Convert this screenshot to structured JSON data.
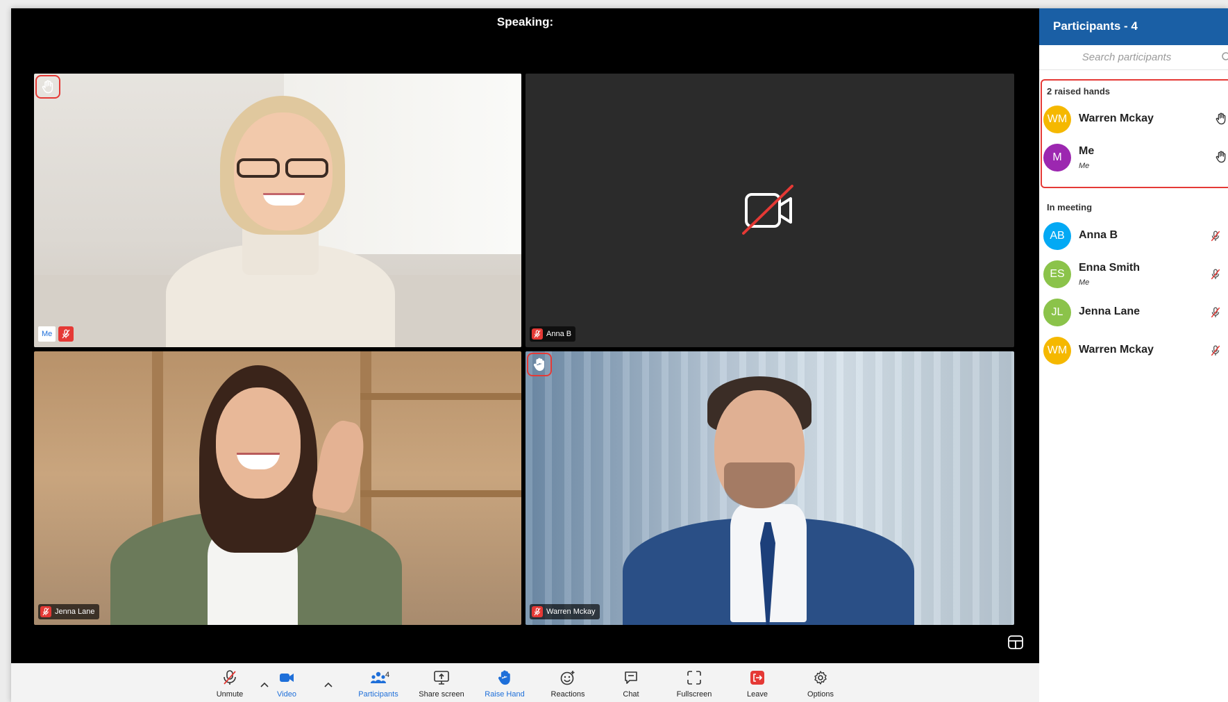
{
  "stage": {
    "speaking_label": "Speaking:"
  },
  "tiles": {
    "me": {
      "label": "Me",
      "hand_raised": true,
      "muted": true
    },
    "anna": {
      "label": "Anna B",
      "camera_off": true,
      "muted": true
    },
    "jenna": {
      "label": "Jenna Lane",
      "muted": true
    },
    "warren": {
      "label": "Warren Mckay",
      "hand_raised": true,
      "muted": true
    }
  },
  "toolbar": {
    "unmute": "Unmute",
    "video": "Video",
    "participants": "Participants",
    "participants_count": "4",
    "share_screen": "Share screen",
    "raise_hand": "Raise Hand",
    "reactions": "Reactions",
    "chat": "Chat",
    "fullscreen": "Fullscreen",
    "leave": "Leave",
    "options": "Options"
  },
  "panel": {
    "title": "Participants - 4",
    "search_placeholder": "Search participants",
    "raised_title": "2 raised hands",
    "raised": [
      {
        "initials": "WM",
        "name": "Warren Mckay",
        "sub": "",
        "color": "#f5b800"
      },
      {
        "initials": "M",
        "name": "Me",
        "sub": "Me",
        "color": "#9c27b0"
      }
    ],
    "in_meeting_title": "In meeting",
    "in_meeting": [
      {
        "initials": "AB",
        "name": "Anna B",
        "sub": "",
        "color": "#03a9f4"
      },
      {
        "initials": "ES",
        "name": "Enna Smith",
        "sub": "Me",
        "color": "#8bc34a"
      },
      {
        "initials": "JL",
        "name": "Jenna Lane",
        "sub": "",
        "color": "#8bc34a"
      },
      {
        "initials": "WM",
        "name": "Warren Mckay",
        "sub": "",
        "color": "#f5b800"
      }
    ]
  },
  "colors": {
    "accent": "#1e6fd9",
    "header": "#1a5fa5",
    "alert": "#e53935"
  }
}
